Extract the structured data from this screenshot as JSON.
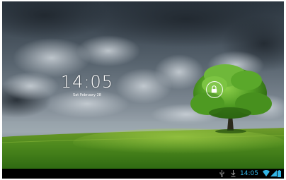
{
  "lockscreen": {
    "time": "14:05",
    "date": "Sat February 28",
    "unlock_icon": "lock-icon"
  },
  "status_bar": {
    "time": "14:05",
    "icons": [
      "usb-icon",
      "download-icon",
      "wifi-icon",
      "signal-icon",
      "battery-icon"
    ],
    "accent_color": "#33b5e5"
  }
}
